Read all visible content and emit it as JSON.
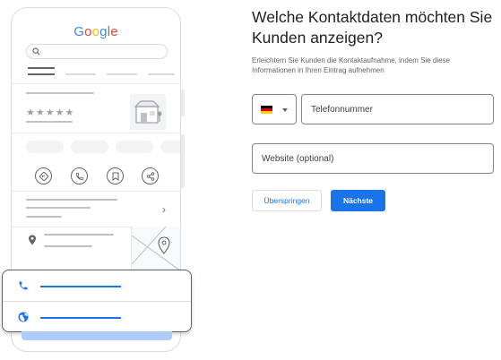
{
  "illustration": {
    "logo_letters": [
      {
        "char": "G",
        "color": "#4285f4"
      },
      {
        "char": "o",
        "color": "#ea4335"
      },
      {
        "char": "o",
        "color": "#fbbc05"
      },
      {
        "char": "g",
        "color": "#4285f4"
      },
      {
        "char": "l",
        "color": "#34a853"
      },
      {
        "char": "e",
        "color": "#ea4335"
      }
    ],
    "rating_stars": "★★★★★",
    "icons": [
      "search-icon",
      "directions-icon",
      "phone-icon",
      "bookmark-icon",
      "share-icon",
      "chevron-right-icon",
      "location-pin-icon",
      "globe-icon"
    ]
  },
  "form": {
    "title": "Welche Kontaktdaten möchten Sie Kunden anzeigen?",
    "subtitle": "Erleichtern Sie Kunden die Kontaktaufnahme, indem Sie diese Informationen in Ihren Eintrag aufnehmen",
    "country_flag": "germany-flag",
    "phone_placeholder": "Telefonnummer",
    "website_placeholder": "Website (optional)",
    "skip_label": "Überspringen",
    "next_label": "Nächste"
  },
  "colors": {
    "accent": "#1a73e8",
    "card_highlight": "#aecbfa"
  }
}
